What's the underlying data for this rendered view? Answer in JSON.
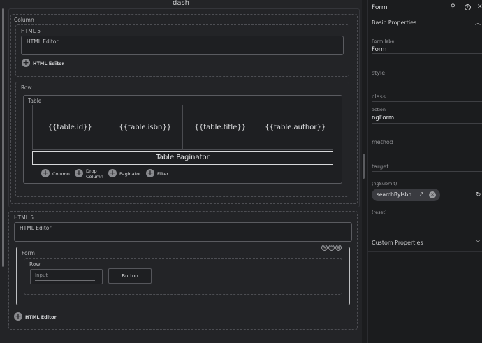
{
  "canvas": {
    "title": "dash",
    "column_label": "Column",
    "html5_label": "HTML 5",
    "html_editor_box": "HTML Editor",
    "add_html_editor": "HTML Editor",
    "row_label": "Row",
    "table_label": "Table",
    "table_cells": [
      "{{table.id}}",
      "{{table.isbn}}",
      "{{table.title}}",
      "{{table.author}}"
    ],
    "paginator": "Table Paginator",
    "table_actions": [
      "Column",
      "Drop Column",
      "Paginator",
      "Filter"
    ],
    "html5_label_2": "HTML 5",
    "html_editor_box_2": "HTML Editor",
    "form_label": "Form",
    "form_row_label": "Row",
    "input_placeholder": "Input",
    "button_label": "Button",
    "add_html_editor_2": "HTML Editor"
  },
  "panel": {
    "title": "Form",
    "icons": [
      "search-icon",
      "help-icon",
      "close-icon"
    ],
    "basic_properties": "Basic Properties",
    "form_label_caption": "Form label",
    "form_label_value": "Form",
    "style_placeholder": "style",
    "class_placeholder": "class",
    "action_caption": "action",
    "action_value": "ngForm",
    "method_placeholder": "method",
    "target_placeholder": "target",
    "ngsubmit_caption": "(ngSubmit)",
    "ngsubmit_chip": "searchByIsbn",
    "reset_caption": "(reset)",
    "custom_properties": "Custom Properties"
  }
}
